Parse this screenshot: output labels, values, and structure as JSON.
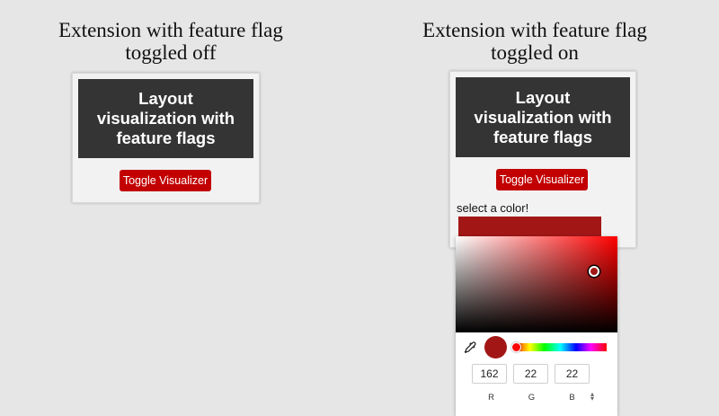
{
  "left_panel": {
    "caption": "Extension with feature flag\ntoggled off",
    "header_title": "Layout\nvisualization with\nfeature flags",
    "toggle_button_label": "Toggle Visualizer"
  },
  "right_panel": {
    "caption": "Extension with feature flag\ntoggled on",
    "header_title": "Layout\nvisualization with\nfeature flags",
    "toggle_button_label": "Toggle Visualizer",
    "select_color_label": "select a color!",
    "selected_color": "#a21616"
  },
  "color_picker": {
    "hue_color": "#ff0000",
    "icons": [
      "eyedropper-icon",
      "format-toggle-icon"
    ],
    "rgb": {
      "r_value": "162",
      "g_value": "22",
      "b_value": "22",
      "r_label": "R",
      "g_label": "G",
      "b_label": "B"
    }
  },
  "colors": {
    "background": "#e6e6e6",
    "header_bg": "#343434",
    "button_bg": "#c20000"
  }
}
